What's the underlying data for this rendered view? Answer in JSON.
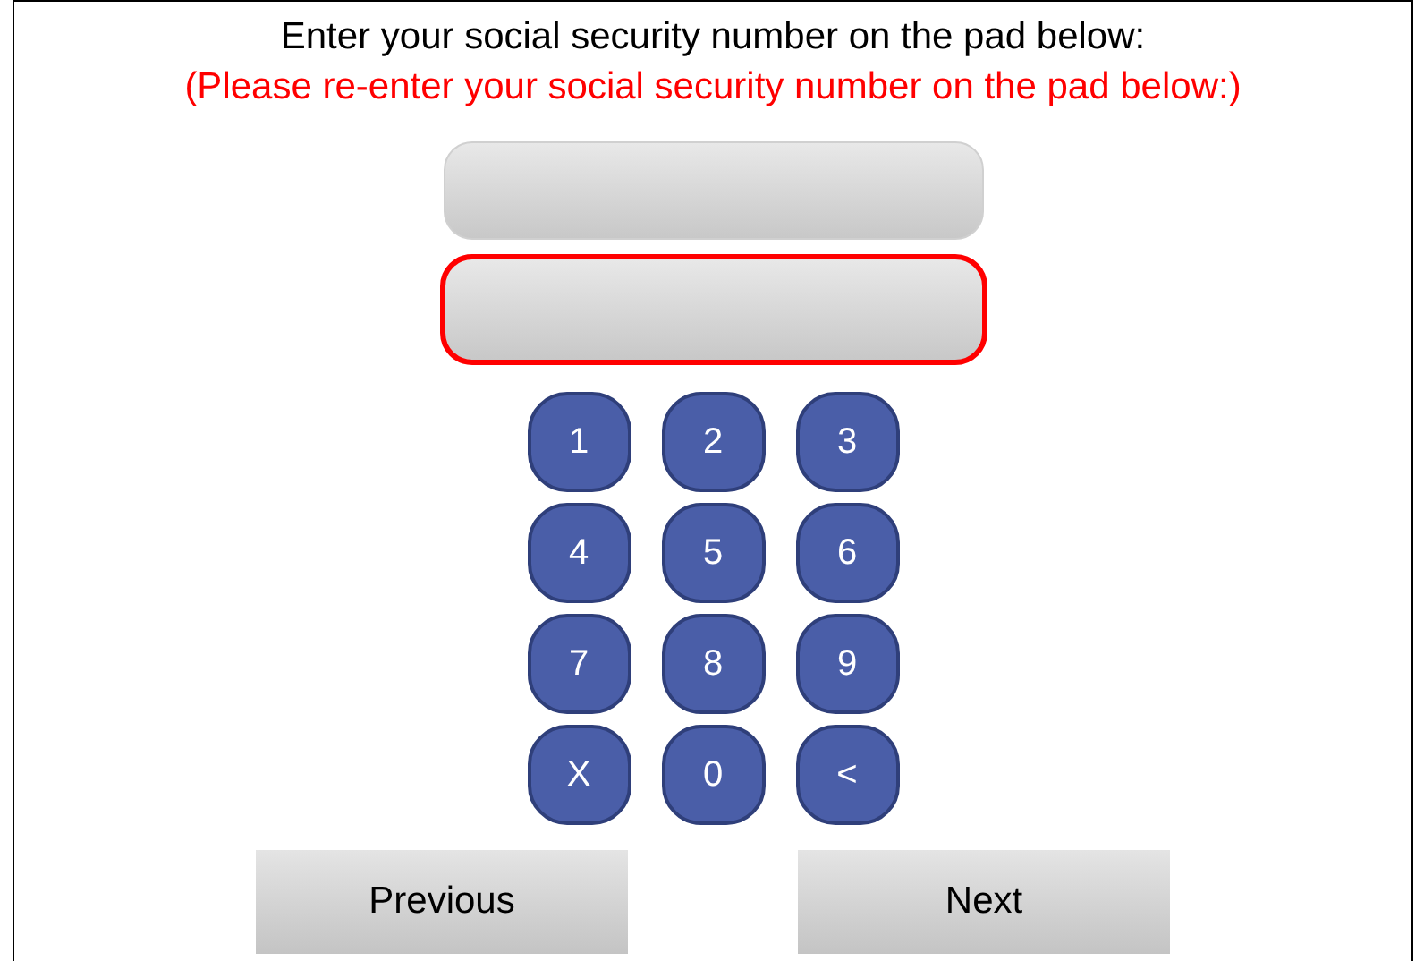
{
  "prompt": "Enter your social security number on the pad below:",
  "reprompt": "(Please re-enter your social security number on the pad below:)",
  "fields": [
    {
      "error": false
    },
    {
      "error": true
    }
  ],
  "keys": [
    "1",
    "2",
    "3",
    "4",
    "5",
    "6",
    "7",
    "8",
    "9",
    "X",
    "0",
    "<"
  ],
  "buttons": [
    "Previous",
    "Next"
  ]
}
